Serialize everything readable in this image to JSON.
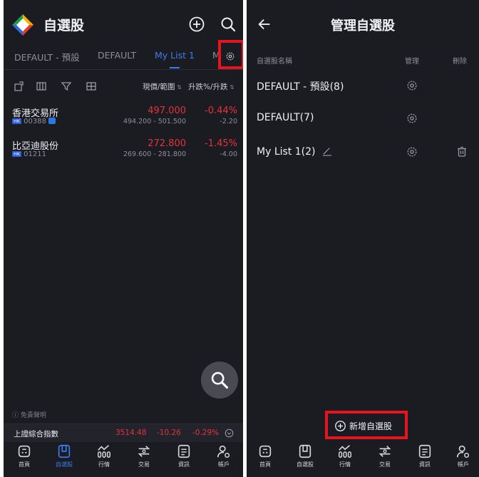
{
  "left": {
    "app_title": "自選股",
    "tabs": [
      {
        "label": "DEFAULT - 預設",
        "active": false
      },
      {
        "label": "DEFAULT",
        "active": false
      },
      {
        "label": "My List 1",
        "active": true
      },
      {
        "label": "M",
        "active": false
      }
    ],
    "columns": {
      "price_range": "現價/範圍",
      "change": "升跌%/升跌"
    },
    "stocks": [
      {
        "name": "香港交易所",
        "market": "HK",
        "code": "00388",
        "price": "497.000",
        "range": "494.200 - 501.500",
        "change_pct": "-0.44%",
        "change": "-2.20"
      },
      {
        "name": "比亞迪股份",
        "market": "HK",
        "code": "01211",
        "price": "272.800",
        "range": "269.600 - 281.800",
        "change_pct": "-1.45%",
        "change": "-4.00"
      }
    ],
    "disclaimer": "免責聲明",
    "index": {
      "name": "上證綜合指數",
      "value": "3514.48",
      "change": "-10.26",
      "change_pct": "-0.29%"
    }
  },
  "nav": [
    {
      "label": "首頁",
      "icon": "home-icon"
    },
    {
      "label": "自選股",
      "icon": "watchlist-icon"
    },
    {
      "label": "行情",
      "icon": "market-icon"
    },
    {
      "label": "交易",
      "icon": "trade-icon"
    },
    {
      "label": "資訊",
      "icon": "news-icon"
    },
    {
      "label": "帳戶",
      "icon": "account-icon"
    }
  ],
  "right": {
    "title": "管理自選股",
    "columns": {
      "name": "自選股名稱",
      "manage": "管理",
      "delete": "刪除"
    },
    "lists": [
      {
        "name": "DEFAULT - 預設(8)",
        "editable": false,
        "deletable": false
      },
      {
        "name": "DEFAULT(7)",
        "editable": false,
        "deletable": false
      },
      {
        "name": "My List 1(2)",
        "editable": true,
        "deletable": true
      }
    ],
    "add_label": "新增自選股"
  },
  "colors": {
    "background": "#1b1c22",
    "accent": "#3d7cf0",
    "negative": "#e5323c",
    "highlight_box": "#e4151f"
  }
}
